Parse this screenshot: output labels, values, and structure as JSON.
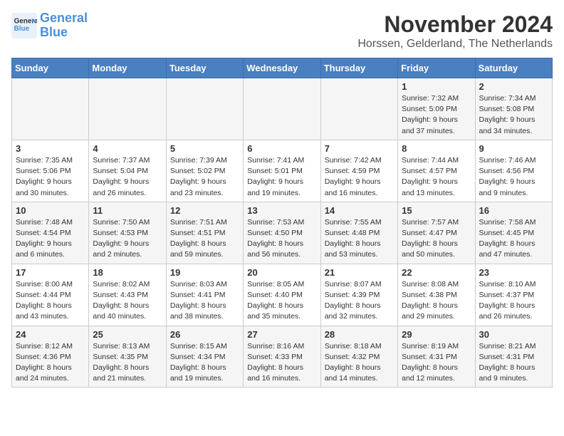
{
  "logo": {
    "line1": "General",
    "line2": "Blue"
  },
  "title": "November 2024",
  "location": "Horssen, Gelderland, The Netherlands",
  "weekdays": [
    "Sunday",
    "Monday",
    "Tuesday",
    "Wednesday",
    "Thursday",
    "Friday",
    "Saturday"
  ],
  "weeks": [
    [
      {
        "day": "",
        "info": ""
      },
      {
        "day": "",
        "info": ""
      },
      {
        "day": "",
        "info": ""
      },
      {
        "day": "",
        "info": ""
      },
      {
        "day": "",
        "info": ""
      },
      {
        "day": "1",
        "info": "Sunrise: 7:32 AM\nSunset: 5:09 PM\nDaylight: 9 hours and 37 minutes."
      },
      {
        "day": "2",
        "info": "Sunrise: 7:34 AM\nSunset: 5:08 PM\nDaylight: 9 hours and 34 minutes."
      }
    ],
    [
      {
        "day": "3",
        "info": "Sunrise: 7:35 AM\nSunset: 5:06 PM\nDaylight: 9 hours and 30 minutes."
      },
      {
        "day": "4",
        "info": "Sunrise: 7:37 AM\nSunset: 5:04 PM\nDaylight: 9 hours and 26 minutes."
      },
      {
        "day": "5",
        "info": "Sunrise: 7:39 AM\nSunset: 5:02 PM\nDaylight: 9 hours and 23 minutes."
      },
      {
        "day": "6",
        "info": "Sunrise: 7:41 AM\nSunset: 5:01 PM\nDaylight: 9 hours and 19 minutes."
      },
      {
        "day": "7",
        "info": "Sunrise: 7:42 AM\nSunset: 4:59 PM\nDaylight: 9 hours and 16 minutes."
      },
      {
        "day": "8",
        "info": "Sunrise: 7:44 AM\nSunset: 4:57 PM\nDaylight: 9 hours and 13 minutes."
      },
      {
        "day": "9",
        "info": "Sunrise: 7:46 AM\nSunset: 4:56 PM\nDaylight: 9 hours and 9 minutes."
      }
    ],
    [
      {
        "day": "10",
        "info": "Sunrise: 7:48 AM\nSunset: 4:54 PM\nDaylight: 9 hours and 6 minutes."
      },
      {
        "day": "11",
        "info": "Sunrise: 7:50 AM\nSunset: 4:53 PM\nDaylight: 9 hours and 2 minutes."
      },
      {
        "day": "12",
        "info": "Sunrise: 7:51 AM\nSunset: 4:51 PM\nDaylight: 8 hours and 59 minutes."
      },
      {
        "day": "13",
        "info": "Sunrise: 7:53 AM\nSunset: 4:50 PM\nDaylight: 8 hours and 56 minutes."
      },
      {
        "day": "14",
        "info": "Sunrise: 7:55 AM\nSunset: 4:48 PM\nDaylight: 8 hours and 53 minutes."
      },
      {
        "day": "15",
        "info": "Sunrise: 7:57 AM\nSunset: 4:47 PM\nDaylight: 8 hours and 50 minutes."
      },
      {
        "day": "16",
        "info": "Sunrise: 7:58 AM\nSunset: 4:45 PM\nDaylight: 8 hours and 47 minutes."
      }
    ],
    [
      {
        "day": "17",
        "info": "Sunrise: 8:00 AM\nSunset: 4:44 PM\nDaylight: 8 hours and 43 minutes."
      },
      {
        "day": "18",
        "info": "Sunrise: 8:02 AM\nSunset: 4:43 PM\nDaylight: 8 hours and 40 minutes."
      },
      {
        "day": "19",
        "info": "Sunrise: 8:03 AM\nSunset: 4:41 PM\nDaylight: 8 hours and 38 minutes."
      },
      {
        "day": "20",
        "info": "Sunrise: 8:05 AM\nSunset: 4:40 PM\nDaylight: 8 hours and 35 minutes."
      },
      {
        "day": "21",
        "info": "Sunrise: 8:07 AM\nSunset: 4:39 PM\nDaylight: 8 hours and 32 minutes."
      },
      {
        "day": "22",
        "info": "Sunrise: 8:08 AM\nSunset: 4:38 PM\nDaylight: 8 hours and 29 minutes."
      },
      {
        "day": "23",
        "info": "Sunrise: 8:10 AM\nSunset: 4:37 PM\nDaylight: 8 hours and 26 minutes."
      }
    ],
    [
      {
        "day": "24",
        "info": "Sunrise: 8:12 AM\nSunset: 4:36 PM\nDaylight: 8 hours and 24 minutes."
      },
      {
        "day": "25",
        "info": "Sunrise: 8:13 AM\nSunset: 4:35 PM\nDaylight: 8 hours and 21 minutes."
      },
      {
        "day": "26",
        "info": "Sunrise: 8:15 AM\nSunset: 4:34 PM\nDaylight: 8 hours and 19 minutes."
      },
      {
        "day": "27",
        "info": "Sunrise: 8:16 AM\nSunset: 4:33 PM\nDaylight: 8 hours and 16 minutes."
      },
      {
        "day": "28",
        "info": "Sunrise: 8:18 AM\nSunset: 4:32 PM\nDaylight: 8 hours and 14 minutes."
      },
      {
        "day": "29",
        "info": "Sunrise: 8:19 AM\nSunset: 4:31 PM\nDaylight: 8 hours and 12 minutes."
      },
      {
        "day": "30",
        "info": "Sunrise: 8:21 AM\nSunset: 4:31 PM\nDaylight: 8 hours and 9 minutes."
      }
    ]
  ]
}
